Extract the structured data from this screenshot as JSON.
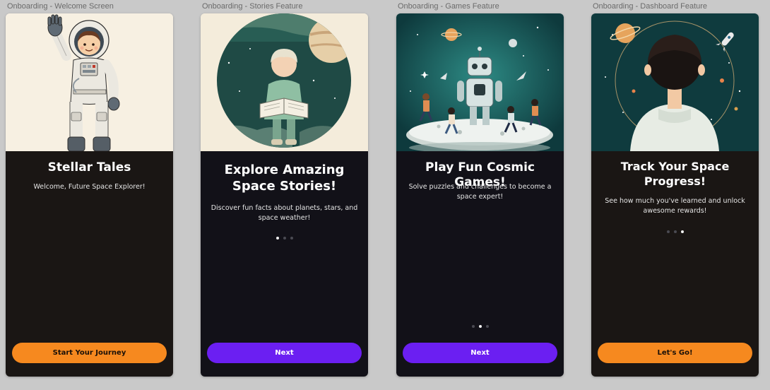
{
  "colors": {
    "canvas": "#c9c9c9",
    "dark_warm": "#1a1614",
    "dark_cool": "#121118",
    "orange": "#f6891f",
    "purple": "#6b1ff2",
    "dot_inactive": "#4a4a52",
    "dot_active": "#f2f2f2"
  },
  "screens": [
    {
      "label": "Onboarding - Welcome Screen",
      "title": "Stellar Tales",
      "subtitle": "Welcome, Future Space Explorer!",
      "button": "Start Your Journey",
      "button_style": "orange",
      "illustration": "astronaut-kid-waving"
    },
    {
      "label": "Onboarding - Stories Feature",
      "title": "Explore Amazing Space Stories!",
      "subtitle": "Discover fun facts about planets, stars, and space weather!",
      "button": "Next",
      "button_style": "purple",
      "active_dot": 1,
      "illustration": "kid-reading-book-in-space"
    },
    {
      "label": "Onboarding - Games Feature",
      "title": "Play Fun Cosmic Games!",
      "subtitle": "Solve puzzles and challenges to become a space expert!",
      "button": "Next",
      "button_style": "purple",
      "active_dot": 2,
      "illustration": "robot-playing-with-kids"
    },
    {
      "label": "Onboarding - Dashboard Feature",
      "title": "Track Your Space Progress!",
      "subtitle": "See how much you've learned and unlock awesome rewards!",
      "button": "Let's Go!",
      "button_style": "orange",
      "active_dot": 3,
      "illustration": "kid-looking-at-space"
    }
  ]
}
